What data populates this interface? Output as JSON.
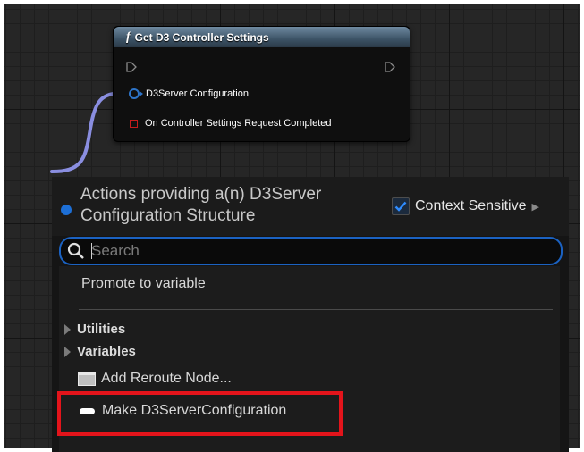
{
  "node": {
    "title": "Get D3 Controller Settings",
    "title_icon": "function-icon",
    "pins": [
      {
        "label": "D3Server Configuration",
        "type": "struct"
      },
      {
        "label": "On Controller Settings Request Completed",
        "type": "delegate"
      }
    ]
  },
  "menu": {
    "title": "Actions providing a(n) D3Server Configuration Structure",
    "context_sensitive_label": "Context Sensitive",
    "context_sensitive_checked": true,
    "search": {
      "placeholder": "Search",
      "value": ""
    },
    "items": {
      "promote": "Promote to variable",
      "utilities": "Utilities",
      "variables": "Variables",
      "reroute": "Add Reroute Node...",
      "make": "Make D3ServerConfiguration"
    }
  },
  "colors": {
    "accent": "#1b62c2",
    "highlight": "#e3141b",
    "struct_pin": "#2d74c8",
    "wire": "#8a8ee0"
  }
}
